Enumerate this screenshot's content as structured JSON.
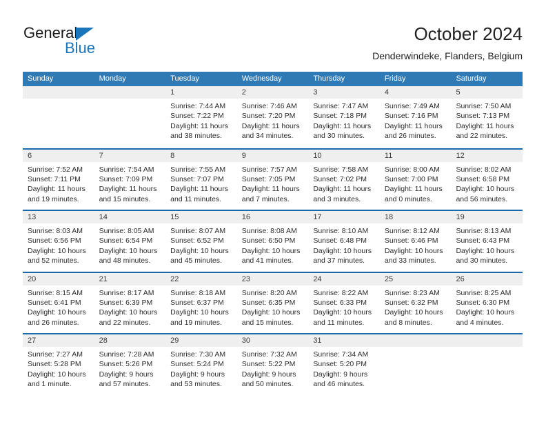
{
  "brand": {
    "name_part1": "General",
    "name_part2": "Blue",
    "triangle_color": "#1b75bb"
  },
  "header": {
    "title": "October 2024",
    "subtitle": "Denderwindeke, Flanders, Belgium"
  },
  "theme": {
    "header_blue": "#2f79b5",
    "row_border_blue": "#1b69ad",
    "daynum_band": "#efefef"
  },
  "weekdays": [
    "Sunday",
    "Monday",
    "Tuesday",
    "Wednesday",
    "Thursday",
    "Friday",
    "Saturday"
  ],
  "weeks": [
    [
      {
        "day": "",
        "lines": []
      },
      {
        "day": "",
        "lines": []
      },
      {
        "day": "1",
        "lines": [
          "Sunrise: 7:44 AM",
          "Sunset: 7:22 PM",
          "Daylight: 11 hours",
          "and 38 minutes."
        ]
      },
      {
        "day": "2",
        "lines": [
          "Sunrise: 7:46 AM",
          "Sunset: 7:20 PM",
          "Daylight: 11 hours",
          "and 34 minutes."
        ]
      },
      {
        "day": "3",
        "lines": [
          "Sunrise: 7:47 AM",
          "Sunset: 7:18 PM",
          "Daylight: 11 hours",
          "and 30 minutes."
        ]
      },
      {
        "day": "4",
        "lines": [
          "Sunrise: 7:49 AM",
          "Sunset: 7:16 PM",
          "Daylight: 11 hours",
          "and 26 minutes."
        ]
      },
      {
        "day": "5",
        "lines": [
          "Sunrise: 7:50 AM",
          "Sunset: 7:13 PM",
          "Daylight: 11 hours",
          "and 22 minutes."
        ]
      }
    ],
    [
      {
        "day": "6",
        "lines": [
          "Sunrise: 7:52 AM",
          "Sunset: 7:11 PM",
          "Daylight: 11 hours",
          "and 19 minutes."
        ]
      },
      {
        "day": "7",
        "lines": [
          "Sunrise: 7:54 AM",
          "Sunset: 7:09 PM",
          "Daylight: 11 hours",
          "and 15 minutes."
        ]
      },
      {
        "day": "8",
        "lines": [
          "Sunrise: 7:55 AM",
          "Sunset: 7:07 PM",
          "Daylight: 11 hours",
          "and 11 minutes."
        ]
      },
      {
        "day": "9",
        "lines": [
          "Sunrise: 7:57 AM",
          "Sunset: 7:05 PM",
          "Daylight: 11 hours",
          "and 7 minutes."
        ]
      },
      {
        "day": "10",
        "lines": [
          "Sunrise: 7:58 AM",
          "Sunset: 7:02 PM",
          "Daylight: 11 hours",
          "and 3 minutes."
        ]
      },
      {
        "day": "11",
        "lines": [
          "Sunrise: 8:00 AM",
          "Sunset: 7:00 PM",
          "Daylight: 11 hours",
          "and 0 minutes."
        ]
      },
      {
        "day": "12",
        "lines": [
          "Sunrise: 8:02 AM",
          "Sunset: 6:58 PM",
          "Daylight: 10 hours",
          "and 56 minutes."
        ]
      }
    ],
    [
      {
        "day": "13",
        "lines": [
          "Sunrise: 8:03 AM",
          "Sunset: 6:56 PM",
          "Daylight: 10 hours",
          "and 52 minutes."
        ]
      },
      {
        "day": "14",
        "lines": [
          "Sunrise: 8:05 AM",
          "Sunset: 6:54 PM",
          "Daylight: 10 hours",
          "and 48 minutes."
        ]
      },
      {
        "day": "15",
        "lines": [
          "Sunrise: 8:07 AM",
          "Sunset: 6:52 PM",
          "Daylight: 10 hours",
          "and 45 minutes."
        ]
      },
      {
        "day": "16",
        "lines": [
          "Sunrise: 8:08 AM",
          "Sunset: 6:50 PM",
          "Daylight: 10 hours",
          "and 41 minutes."
        ]
      },
      {
        "day": "17",
        "lines": [
          "Sunrise: 8:10 AM",
          "Sunset: 6:48 PM",
          "Daylight: 10 hours",
          "and 37 minutes."
        ]
      },
      {
        "day": "18",
        "lines": [
          "Sunrise: 8:12 AM",
          "Sunset: 6:46 PM",
          "Daylight: 10 hours",
          "and 33 minutes."
        ]
      },
      {
        "day": "19",
        "lines": [
          "Sunrise: 8:13 AM",
          "Sunset: 6:43 PM",
          "Daylight: 10 hours",
          "and 30 minutes."
        ]
      }
    ],
    [
      {
        "day": "20",
        "lines": [
          "Sunrise: 8:15 AM",
          "Sunset: 6:41 PM",
          "Daylight: 10 hours",
          "and 26 minutes."
        ]
      },
      {
        "day": "21",
        "lines": [
          "Sunrise: 8:17 AM",
          "Sunset: 6:39 PM",
          "Daylight: 10 hours",
          "and 22 minutes."
        ]
      },
      {
        "day": "22",
        "lines": [
          "Sunrise: 8:18 AM",
          "Sunset: 6:37 PM",
          "Daylight: 10 hours",
          "and 19 minutes."
        ]
      },
      {
        "day": "23",
        "lines": [
          "Sunrise: 8:20 AM",
          "Sunset: 6:35 PM",
          "Daylight: 10 hours",
          "and 15 minutes."
        ]
      },
      {
        "day": "24",
        "lines": [
          "Sunrise: 8:22 AM",
          "Sunset: 6:33 PM",
          "Daylight: 10 hours",
          "and 11 minutes."
        ]
      },
      {
        "day": "25",
        "lines": [
          "Sunrise: 8:23 AM",
          "Sunset: 6:32 PM",
          "Daylight: 10 hours",
          "and 8 minutes."
        ]
      },
      {
        "day": "26",
        "lines": [
          "Sunrise: 8:25 AM",
          "Sunset: 6:30 PM",
          "Daylight: 10 hours",
          "and 4 minutes."
        ]
      }
    ],
    [
      {
        "day": "27",
        "lines": [
          "Sunrise: 7:27 AM",
          "Sunset: 5:28 PM",
          "Daylight: 10 hours",
          "and 1 minute."
        ]
      },
      {
        "day": "28",
        "lines": [
          "Sunrise: 7:28 AM",
          "Sunset: 5:26 PM",
          "Daylight: 9 hours",
          "and 57 minutes."
        ]
      },
      {
        "day": "29",
        "lines": [
          "Sunrise: 7:30 AM",
          "Sunset: 5:24 PM",
          "Daylight: 9 hours",
          "and 53 minutes."
        ]
      },
      {
        "day": "30",
        "lines": [
          "Sunrise: 7:32 AM",
          "Sunset: 5:22 PM",
          "Daylight: 9 hours",
          "and 50 minutes."
        ]
      },
      {
        "day": "31",
        "lines": [
          "Sunrise: 7:34 AM",
          "Sunset: 5:20 PM",
          "Daylight: 9 hours",
          "and 46 minutes."
        ]
      },
      {
        "day": "",
        "lines": []
      },
      {
        "day": "",
        "lines": []
      }
    ]
  ]
}
